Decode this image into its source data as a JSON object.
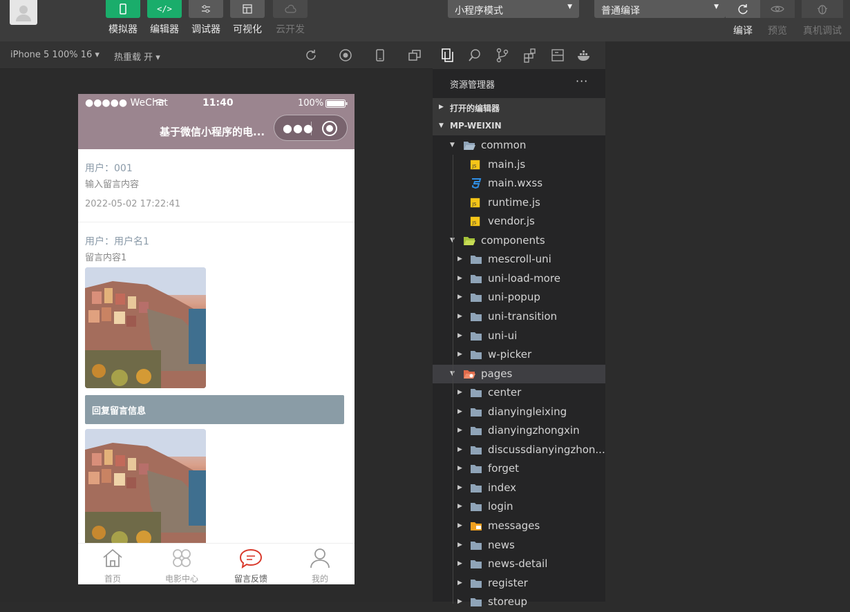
{
  "toolbar": {
    "tools": [
      {
        "label": "模拟器",
        "icon": "phone-icon"
      },
      {
        "label": "编辑器",
        "icon": "code-icon"
      },
      {
        "label": "调试器",
        "icon": "sliders-icon"
      },
      {
        "label": "可视化",
        "icon": "layout-icon"
      },
      {
        "label": "云开发",
        "icon": "cloud-icon"
      }
    ],
    "mode_select": "小程序模式",
    "compile_select": "普通编译",
    "right_tools": [
      {
        "label": "编译",
        "icon": "refresh-icon"
      },
      {
        "label": "预览",
        "icon": "eye-icon"
      },
      {
        "label": "真机调试",
        "icon": "bug-icon"
      }
    ]
  },
  "simbar": {
    "device": "iPhone 5 100% 16 ▾",
    "hot_reload": "热重载 开 ▾"
  },
  "phone": {
    "status": {
      "carrier": "●●●●● WeChat",
      "time": "11:40",
      "battery": "100%"
    },
    "nav_title": "基于微信小程序的电...",
    "messages": [
      {
        "user": "用户：001",
        "text": "输入留言内容",
        "time": "2022-05-02 17:22:41"
      },
      {
        "user": "用户：用户名1",
        "text": "留言内容1"
      }
    ],
    "reply_label": "回复留言信息",
    "tabs": [
      {
        "label": "首页",
        "icon": "home-icon"
      },
      {
        "label": "电影中心",
        "icon": "grid-icon"
      },
      {
        "label": "留言反馈",
        "icon": "chat-icon"
      },
      {
        "label": "我的",
        "icon": "user-icon"
      }
    ],
    "accent_color": "#9b858f"
  },
  "explorer": {
    "title": "资源管理器",
    "more": "···",
    "sections": [
      "打开的编辑器",
      "MP-WEIXIN"
    ],
    "tree": [
      {
        "label": "common",
        "depth": 1,
        "type": "folder-open"
      },
      {
        "label": "main.js",
        "depth": 2,
        "type": "js"
      },
      {
        "label": "main.wxss",
        "depth": 2,
        "type": "css"
      },
      {
        "label": "runtime.js",
        "depth": 2,
        "type": "js"
      },
      {
        "label": "vendor.js",
        "depth": 2,
        "type": "js"
      },
      {
        "label": "components",
        "depth": 1,
        "type": "folder-open-green"
      },
      {
        "label": "mescroll-uni",
        "depth": 2,
        "type": "folder"
      },
      {
        "label": "uni-load-more",
        "depth": 2,
        "type": "folder"
      },
      {
        "label": "uni-popup",
        "depth": 2,
        "type": "folder"
      },
      {
        "label": "uni-transition",
        "depth": 2,
        "type": "folder"
      },
      {
        "label": "uni-ui",
        "depth": 2,
        "type": "folder"
      },
      {
        "label": "w-picker",
        "depth": 2,
        "type": "folder"
      },
      {
        "label": "pages",
        "depth": 1,
        "type": "folder-open-red"
      },
      {
        "label": "center",
        "depth": 2,
        "type": "folder"
      },
      {
        "label": "dianyingleixing",
        "depth": 2,
        "type": "folder"
      },
      {
        "label": "dianyingzhongxin",
        "depth": 2,
        "type": "folder"
      },
      {
        "label": "discussdianyingzhon...",
        "depth": 2,
        "type": "folder"
      },
      {
        "label": "forget",
        "depth": 2,
        "type": "folder"
      },
      {
        "label": "index",
        "depth": 2,
        "type": "folder"
      },
      {
        "label": "login",
        "depth": 2,
        "type": "folder"
      },
      {
        "label": "messages",
        "depth": 2,
        "type": "folder-orange"
      },
      {
        "label": "news",
        "depth": 2,
        "type": "folder"
      },
      {
        "label": "news-detail",
        "depth": 2,
        "type": "folder"
      },
      {
        "label": "register",
        "depth": 2,
        "type": "folder"
      },
      {
        "label": "storeup",
        "depth": 2,
        "type": "folder"
      }
    ]
  }
}
